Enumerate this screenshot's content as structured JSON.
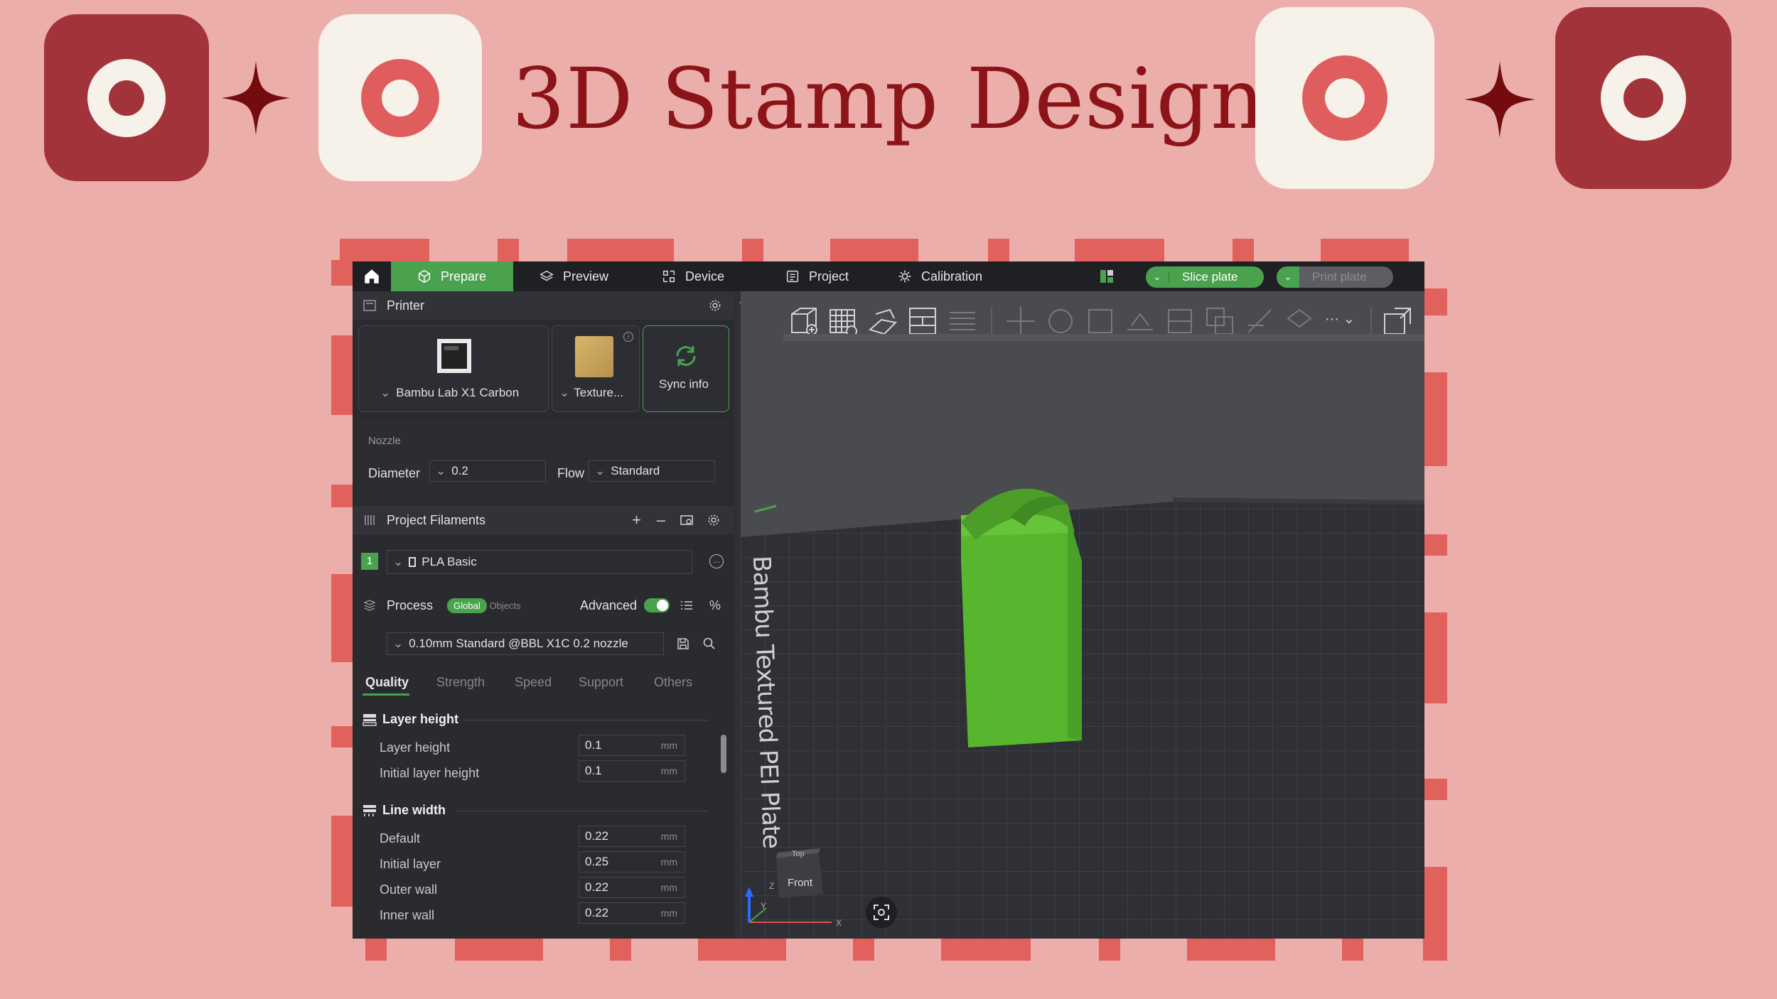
{
  "header": {
    "title": "3D Stamp Design"
  },
  "colors": {
    "background": "#ebaeab",
    "accent_red": "#a3333a",
    "cream": "#f6f1e9",
    "ring_red": "#e05d5d",
    "title_red": "#8c1418",
    "app_green": "#4aa24e",
    "model_green": "#57b52e"
  },
  "topbar": {
    "tabs": [
      {
        "label": "Prepare",
        "icon": "cube-icon",
        "active": true
      },
      {
        "label": "Preview",
        "icon": "layers-icon"
      },
      {
        "label": "Device",
        "icon": "device-icon"
      },
      {
        "label": "Project",
        "icon": "project-icon"
      },
      {
        "label": "Calibration",
        "icon": "calibration-icon"
      }
    ],
    "slice_label": "Slice plate",
    "print_label": "Print plate"
  },
  "printer": {
    "section_label": "Printer",
    "printer_name": "Bambu Lab X1 Carbon",
    "plate_name": "Texture...",
    "sync_label": "Sync info",
    "nozzle_label": "Nozzle",
    "diameter_label": "Diameter",
    "diameter_value": "0.2",
    "flow_label": "Flow",
    "flow_value": "Standard"
  },
  "filaments": {
    "section_label": "Project Filaments",
    "items": [
      {
        "index": "1",
        "name": "PLA Basic",
        "color": "#4aa24e"
      }
    ]
  },
  "process": {
    "section_label": "Process",
    "global_label": "Global",
    "objects_label": "Objects",
    "advanced_label": "Advanced",
    "advanced_on": true,
    "profile": "0.10mm Standard @BBL X1C 0.2 nozzle",
    "tabs": [
      "Quality",
      "Strength",
      "Speed",
      "Support",
      "Others"
    ],
    "active_tab": "Quality",
    "groups": [
      {
        "title": "Layer height",
        "rows": [
          {
            "label": "Layer height",
            "value": "0.1",
            "unit": "mm"
          },
          {
            "label": "Initial layer height",
            "value": "0.1",
            "unit": "mm"
          }
        ]
      },
      {
        "title": "Line width",
        "rows": [
          {
            "label": "Default",
            "value": "0.22",
            "unit": "mm"
          },
          {
            "label": "Initial layer",
            "value": "0.25",
            "unit": "mm"
          },
          {
            "label": "Outer wall",
            "value": "0.22",
            "unit": "mm"
          },
          {
            "label": "Inner wall",
            "value": "0.22",
            "unit": "mm"
          }
        ]
      }
    ]
  },
  "viewport": {
    "plate_label": "Bambu Textured PEI Plate",
    "navcube_top": "Top",
    "navcube_front": "Front",
    "axis_z": "Z",
    "axis_y": "Y",
    "axis_x": "X"
  }
}
